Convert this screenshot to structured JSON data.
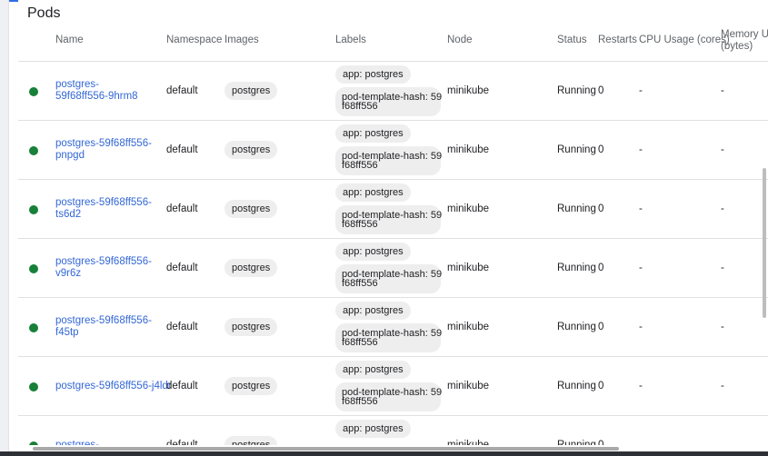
{
  "card_title": "Pods",
  "headers": {
    "name": "Name",
    "namespace": "Namespace",
    "images": "Images",
    "labels": "Labels",
    "node": "Node",
    "status": "Status",
    "restarts": "Restarts",
    "cpu": "CPU Usage (cores)",
    "memory": "Memory U\n(bytes)"
  },
  "rows": [
    {
      "name": "postgres-\n59f68ff556-9hrm8",
      "namespace": "default",
      "image": "postgres",
      "label_app": "app: postgres",
      "label_hash": "pod-template-hash: 59\nf68ff556",
      "node": "minikube",
      "status": "Running",
      "restarts": "0",
      "cpu": "-",
      "memory": "-"
    },
    {
      "name": "postgres-59f68ff556-\npnpgd",
      "namespace": "default",
      "image": "postgres",
      "label_app": "app: postgres",
      "label_hash": "pod-template-hash: 59\nf68ff556",
      "node": "minikube",
      "status": "Running",
      "restarts": "0",
      "cpu": "-",
      "memory": "-"
    },
    {
      "name": "postgres-59f68ff556-\nts6d2",
      "namespace": "default",
      "image": "postgres",
      "label_app": "app: postgres",
      "label_hash": "pod-template-hash: 59\nf68ff556",
      "node": "minikube",
      "status": "Running",
      "restarts": "0",
      "cpu": "-",
      "memory": "-"
    },
    {
      "name": "postgres-59f68ff556-\nv9r6z",
      "namespace": "default",
      "image": "postgres",
      "label_app": "app: postgres",
      "label_hash": "pod-template-hash: 59\nf68ff556",
      "node": "minikube",
      "status": "Running",
      "restarts": "0",
      "cpu": "-",
      "memory": "-"
    },
    {
      "name": "postgres-59f68ff556-\nf45tp",
      "namespace": "default",
      "image": "postgres",
      "label_app": "app: postgres",
      "label_hash": "pod-template-hash: 59\nf68ff556",
      "node": "minikube",
      "status": "Running",
      "restarts": "0",
      "cpu": "-",
      "memory": "-"
    },
    {
      "name": "postgres-59f68ff556-j4ldr",
      "namespace": "default",
      "image": "postgres",
      "label_app": "app: postgres",
      "label_hash": "pod-template-hash: 59\nf68ff556",
      "node": "minikube",
      "status": "Running",
      "restarts": "0",
      "cpu": "-",
      "memory": "-"
    },
    {
      "name": "postgres-",
      "namespace": "default",
      "image": "postgres",
      "label_app": "app: postgres",
      "label_hash": "",
      "node": "minikube",
      "status": "Running",
      "restarts": "0",
      "cpu": "",
      "memory": ""
    }
  ],
  "colors": {
    "status_running": "#188038",
    "link": "#3367d6",
    "chip_bg": "#eeeeee",
    "accent": "#326de6"
  }
}
